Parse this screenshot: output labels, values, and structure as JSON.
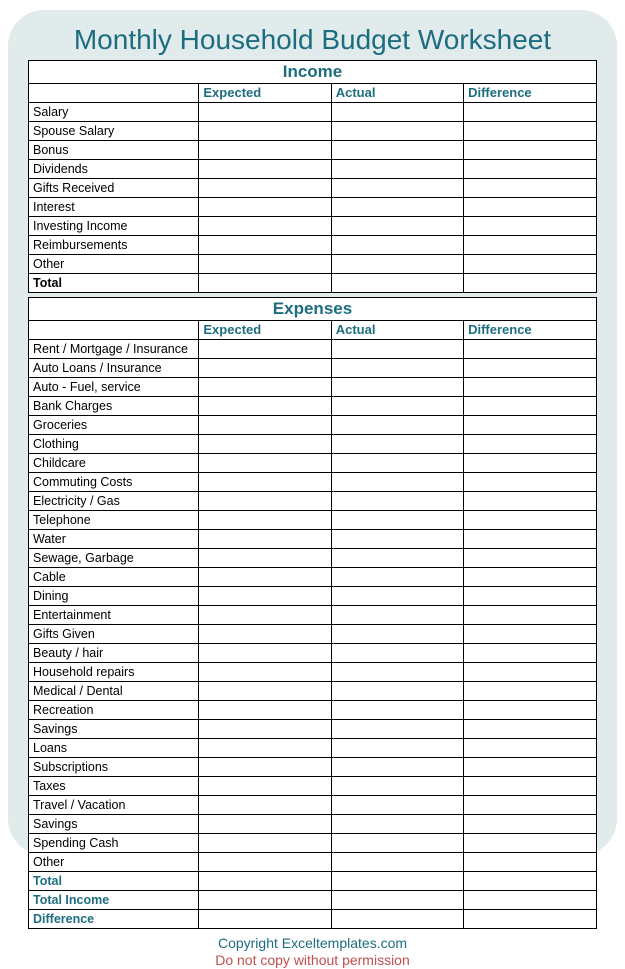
{
  "title": "Monthly Household Budget Worksheet",
  "columns": {
    "expected": "Expected",
    "actual": "Actual",
    "difference": "Difference"
  },
  "income": {
    "heading": "Income",
    "rows": [
      "Salary",
      "Spouse Salary",
      "Bonus",
      "Dividends",
      "Gifts Received",
      "Interest",
      "Investing Income",
      "Reimbursements",
      "Other"
    ],
    "total": "Total"
  },
  "expenses": {
    "heading": "Expenses",
    "rows": [
      "Rent / Mortgage / Insurance",
      "Auto Loans / Insurance",
      "Auto - Fuel, service",
      "Bank Charges",
      "Groceries",
      "Clothing",
      "Childcare",
      "Commuting Costs",
      "Electricity / Gas",
      "Telephone",
      "Water",
      "Sewage, Garbage",
      "Cable",
      "Dining",
      "Entertainment",
      "Gifts Given",
      "Beauty / hair",
      "Household repairs",
      "Medical / Dental",
      "Recreation",
      "Savings",
      "Loans",
      "Subscriptions",
      "Taxes",
      "Travel / Vacation",
      "Savings",
      "Spending Cash",
      "Other"
    ],
    "total": "Total",
    "total_income": "Total Income",
    "difference": "Difference"
  },
  "footer": {
    "copyright": "Copyright Exceltemplates.com",
    "warning": "Do not copy without permission"
  }
}
